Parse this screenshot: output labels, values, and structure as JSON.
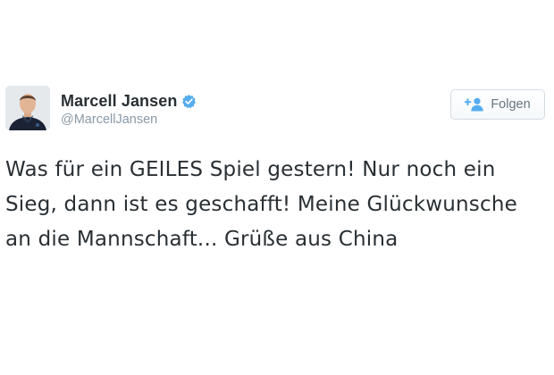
{
  "tweet": {
    "author": {
      "display_name": "Marcell Jansen",
      "handle": "@MarcellJansen",
      "verified": true,
      "avatar_icon": "profile-photo"
    },
    "follow_button": {
      "label": "Folgen",
      "icon": "follow-person-plus-icon"
    },
    "text": "Was für ein GEILES Spiel gestern! Nur noch ein Sieg, dann ist es geschafft! Meine Glückwunsche an die Mannschaft... Grüße aus China"
  },
  "colors": {
    "verified_badge": "#55acee",
    "follow_icon": "#55acee",
    "handle": "#8899a6",
    "text": "#292f33"
  }
}
